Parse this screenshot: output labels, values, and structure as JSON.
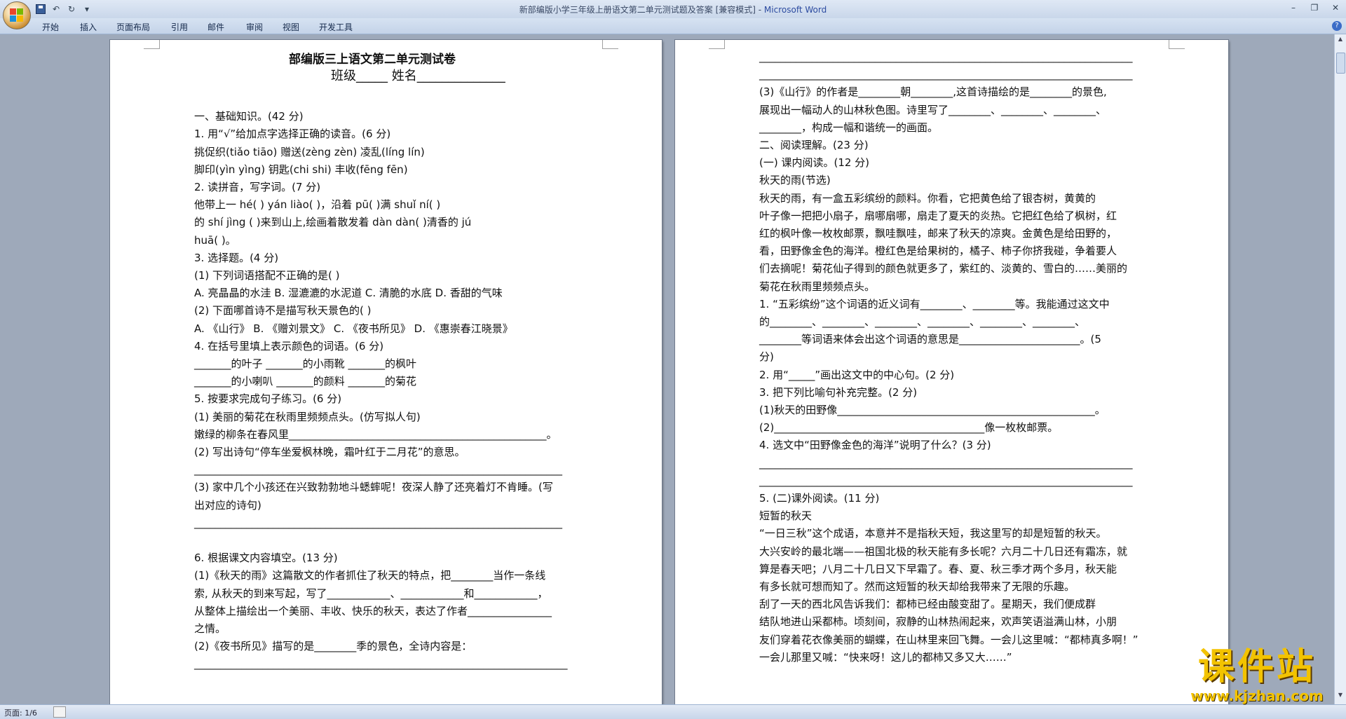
{
  "window": {
    "doc_title": "新部编版小学三年级上册语文第二单元测试题及答案 [兼容模式] - ",
    "app": "Microsoft Word"
  },
  "qat": {
    "save": "save-icon",
    "undo": "↶",
    "redo": "↻",
    "more": "▾"
  },
  "ribbon_tabs": [
    "开始",
    "插入",
    "页面布局",
    "引用",
    "邮件",
    "审阅",
    "视图",
    "开发工具"
  ],
  "help": "?",
  "window_controls": [
    "–",
    "❐",
    "✕"
  ],
  "page1_lines": [
    "部编版三上语文第二单元测试卷",
    "班级_____     姓名______________",
    "",
    "一、基础知识。(42 分)",
    "1. 用“√”给加点字选择正确的读音。(6 分)",
    "挑促织(tiǎo  tiāo)     赠送(zèng   zèn)      凌乱(líng   lín)",
    "脚印(yìn   yìng)         钥匙(chi   shi)        丰收(fēng   fēn)",
    "2. 读拼音，写字词。(7 分)",
    "   他带上一 hé(          ) yán liào(          )，沿着 pū(       )满 shuǐ ní(            )",
    "的 shí jìng (                  )来到山上,绘画着散发着 dàn dàn(              )清香的 jú",
    "huā(               )。",
    "3. 选择题。(4 分)",
    "(1) 下列词语搭配不正确的是(          )",
    "A. 亮晶晶的水洼     B. 湿漉漉的水泥道    C. 清脆的水底       D. 香甜的气味",
    "(2) 下面哪首诗不是描写秋天景色的(          )",
    "A. 《山行》 B. 《赠刘景文》 C. 《夜书所见》 D. 《惠崇春江晓景》",
    "4. 在括号里填上表示颜色的词语。(6 分)",
    "_______的叶子         _______的小雨靴          _______的枫叶",
    " _______的小喇叭        _______的颜料           _______的菊花",
    "5. 按要求完成句子练习。(6 分)",
    "(1) 美丽的菊花在秋雨里频频点头。(仿写拟人句)",
    " 嫩绿的柳条在春风里_________________________________________________。",
    "(2) 写出诗句“停车坐爱枫林晚，霜叶红于二月花”的意思。",
    "______________________________________________________________________",
    "(3) 家中几个小孩还在兴致勃勃地斗蟋蟀呢！夜深人静了还亮着灯不肯睡。(写",
    "出对应的诗句)",
    "______________________________________________________________________",
    "",
    "6. 根据课文内容填空。(13 分)",
    " (1)《秋天的雨》这篇散文的作者抓住了秋天的特点，把________当作一条线",
    " 索, 从秋天的到来写起，写了____________、____________和____________，",
    " 从整体上描绘出一个美丽、丰收、快乐的秋天，表达了作者________________",
    " 之情。",
    " (2)《夜书所见》描写的是________季的景色，全诗内容是：",
    " _______________________________________________________________________"
  ],
  "page2_lines": [
    "_______________________________________________________________________",
    "_______________________________________________________________________",
    " (3)《山行》的作者是________朝________,这首诗描绘的是________的景色,",
    " 展现出一幅动人的山林秋色图。诗里写了________、________、________、",
    " ________，构成一幅和谐统一的画面。",
    "二、阅读理解。(23 分)",
    " (一)    课内阅读。(12 分)",
    "                                     秋天的雨(节选)",
    "     秋天的雨，有一盒五彩缤纷的颜料。你看，它把黄色给了银杏树，黄黄的",
    "叶子像一把把小扇子，扇哪扇哪，扇走了夏天的炎热。它把红色给了枫树，红",
    "红的枫叶像一枚枚邮票，飘哇飘哇，邮来了秋天的凉爽。金黄色是给田野的，",
    "看，田野像金色的海洋。橙红色是给果树的，橘子、柿子你挤我碰，争着要人",
    "们去摘呢！菊花仙子得到的颜色就更多了，紫红的、淡黄的、雪白的……美丽的",
    "菊花在秋雨里频频点头。",
    "1. “五彩缤纷”这个词语的近义词有________、________等。我能通过这文中",
    "的________、________、________、________、________、________、",
    "________等词语来体会出这个词语的意思是_______________________。(5",
    "分)",
    "2. 用“_____”画出这文中的中心句。(2 分)",
    "3. 把下列比喻句补充完整。(2 分)",
    " (1)秋天的田野像_________________________________________________。",
    " (2)________________________________________像一枚枚邮票。",
    "4. 选文中“田野像金色的海洋”说明了什么？(3 分)",
    "_______________________________________________________________________",
    "_______________________________________________________________________",
    "5. (二)课外阅读。(11 分)",
    "                                          短暂的秋天",
    "     “一日三秋”这个成语，本意并不是指秋天短，我这里写的却是短暂的秋天。",
    "大兴安岭的最北端——祖国北极的秋天能有多长呢？六月二十几日还有霜冻，就",
    "算是春天吧；八月二十几日又下早霜了。春、夏、秋三季才两个多月，秋天能",
    "有多长就可想而知了。然而这短暂的秋天却给我带来了无限的乐趣。",
    "     刮了一天的西北风告诉我们：都柿已经由酸变甜了。星期天，我们便成群",
    "结队地进山采都柿。顷刻间，寂静的山林热闹起来，欢声笑语溢满山林，小朋",
    "友们穿着花衣像美丽的蝴蝶，在山林里来回飞舞。一会儿这里喊：“都柿真多啊！”",
    "一会儿那里又喊：“快来呀！这儿的都柿又多又大……”"
  ],
  "status": {
    "page": "页面: 1/6"
  },
  "watermark": {
    "big": "课件站",
    "url": "www.kjzhan.com"
  },
  "colors": {
    "titlebar": "#dfe8f5",
    "workspace": "#9ea9ba",
    "watermark": "#f3c300"
  }
}
